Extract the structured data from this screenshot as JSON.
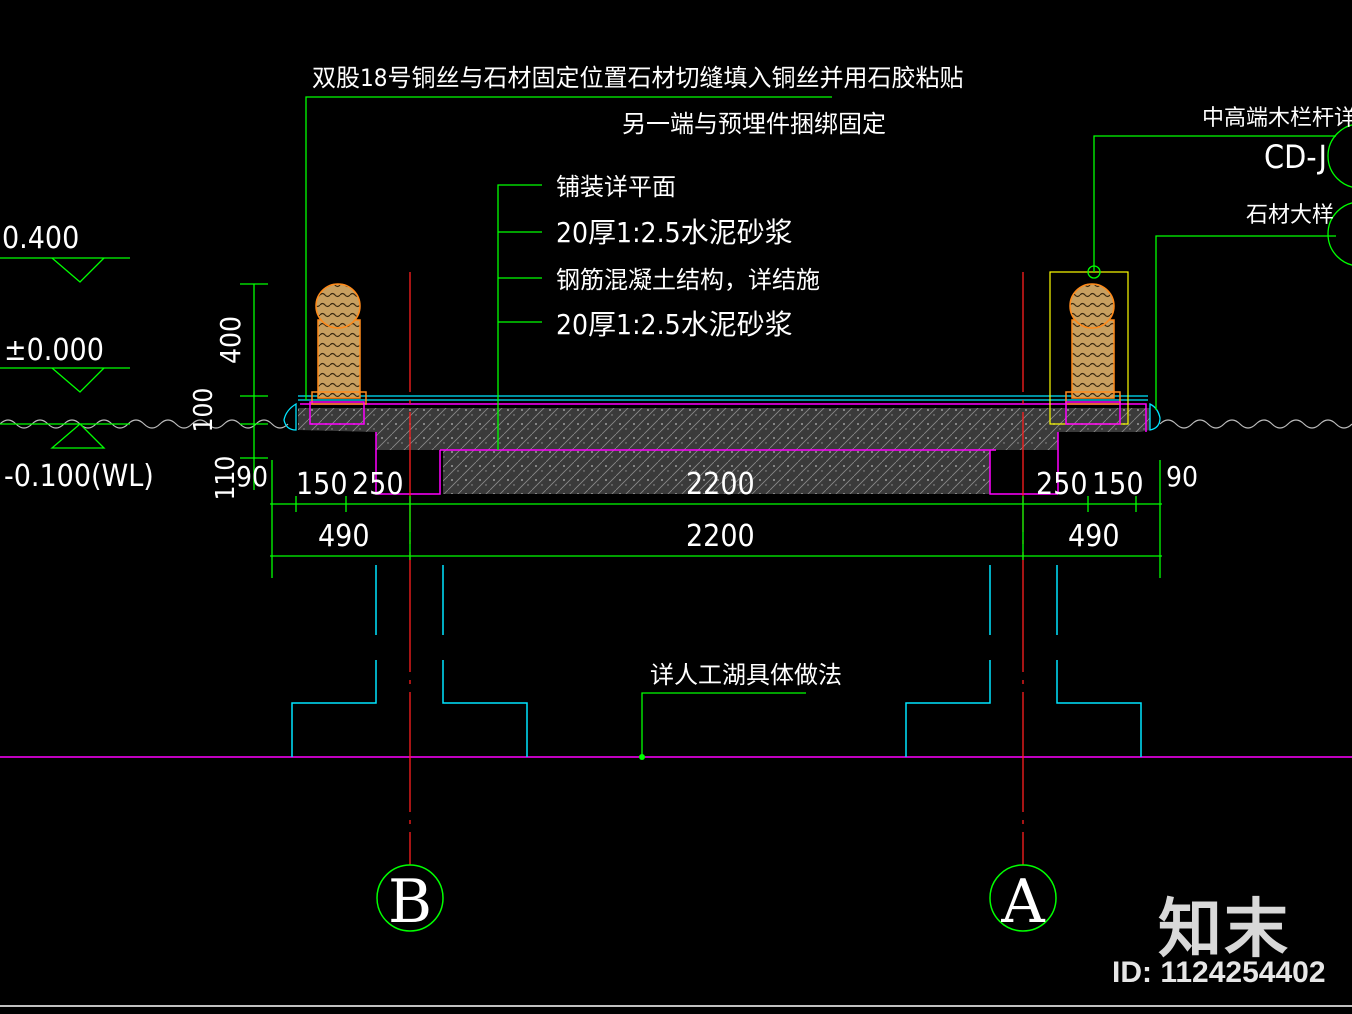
{
  "notes": {
    "wire_line1": "双股18号铜丝与石材固定位置石材切缝填入铜丝并用石胶粘贴",
    "wire_line2": "另一端与预埋件捆绑固定",
    "layers": [
      "铺装详平面",
      "20厚1:2.5水泥砂浆",
      "钢筋混凝土结构，详结施",
      "20厚1:2.5水泥砂浆"
    ],
    "railing_ref": "中高端木栏杆详",
    "railing_ref_code": "CD-J",
    "stone_ref": "石材大样",
    "lake_ref": "详人工湖具体做法"
  },
  "levels": {
    "top": "0.400",
    "zero": "±0.000",
    "water": "-0.100(WL)"
  },
  "vertical_dims": {
    "d400": "400",
    "d100": "100",
    "d110": "110"
  },
  "dims_row1": {
    "a": "90",
    "b": "150",
    "c": "250",
    "d": "2200",
    "e": "250",
    "f": "150",
    "g": "90"
  },
  "dims_row2": {
    "a": "490",
    "b": "2200",
    "c": "490"
  },
  "axes": {
    "left": "B",
    "right": "A"
  },
  "watermark": {
    "logo": "知末",
    "id": "ID: 1124254402"
  },
  "colors": {
    "green": "#00ff00",
    "cyan": "#00e5ff",
    "magenta": "#ff00ff",
    "red": "#ff2020",
    "white": "#ffffff",
    "yellow": "#ffff00",
    "orange": "#ff8a1a"
  }
}
